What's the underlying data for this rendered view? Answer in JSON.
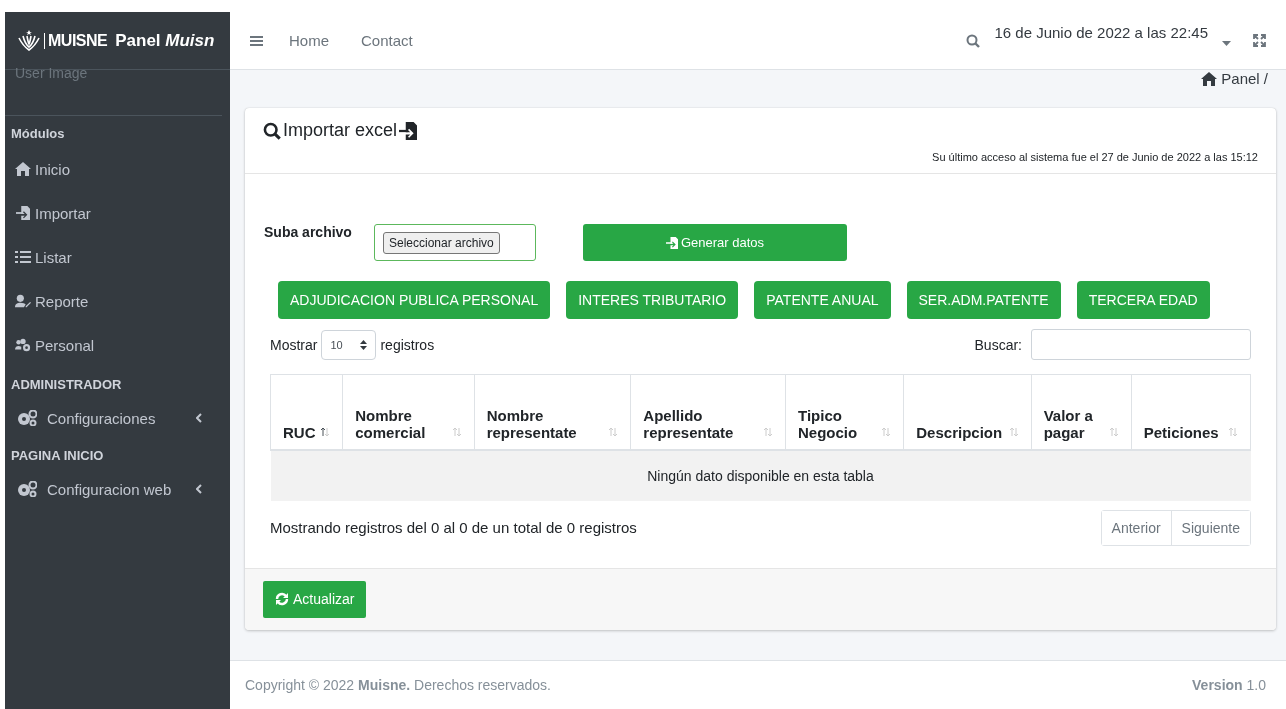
{
  "brand": {
    "logo_text": "MUISNE",
    "title": "Panel ",
    "title_italic": "Muisn"
  },
  "user_image_alt": "User Image",
  "navbar": {
    "links": [
      "Home",
      "Contact"
    ],
    "datetime": "16 de Junio de 2022 a las 22:45"
  },
  "sidebar": {
    "items": [
      {
        "kind": "header",
        "label": "Módulos"
      },
      {
        "kind": "link",
        "label": "Inicio",
        "has_submenu": false
      },
      {
        "kind": "link",
        "label": "Importar",
        "has_submenu": false
      },
      {
        "kind": "link",
        "label": "Listar",
        "has_submenu": false
      },
      {
        "kind": "link",
        "label": "Reporte",
        "has_submenu": false
      },
      {
        "kind": "link",
        "label": "Personal",
        "has_submenu": false
      },
      {
        "kind": "header",
        "label": "ADMINISTRADOR"
      },
      {
        "kind": "link",
        "label": "Configuraciones",
        "has_submenu": true
      },
      {
        "kind": "header",
        "label": "PAGINA INICIO"
      },
      {
        "kind": "link",
        "label": "Configuracion web",
        "has_submenu": true
      }
    ]
  },
  "breadcrumb": "Panel /",
  "card": {
    "title": "Importar excel",
    "last_access": "Su último acceso al sistema fue el 27 de Junio de 2022 a las 15:12",
    "upload_label": "Suba archivo",
    "file_button": "Seleccionar archivo",
    "generate_button": "Generar datos",
    "category_buttons": [
      "ADJUDICACION PUBLICA PERSONAL",
      "INTERES TRIBUTARIO",
      "PATENTE ANUAL",
      "SER.ADM.PATENTE",
      "TERCERA EDAD"
    ],
    "show_prefix": "Mostrar",
    "page_size": "10",
    "show_suffix": "registros",
    "search_label": "Buscar:",
    "table": {
      "columns": [
        {
          "label": "RUC",
          "sorted": true
        },
        {
          "label": "Nombre comercial",
          "sorted": false
        },
        {
          "label": "Nombre representate",
          "sorted": false
        },
        {
          "label": "Apellido representate",
          "sorted": false
        },
        {
          "label": "Tipico Negocio",
          "sorted": false
        },
        {
          "label": "Descripcion",
          "sorted": false
        },
        {
          "label": "Valor a pagar",
          "sorted": false
        },
        {
          "label": "Peticiones",
          "sorted": false
        }
      ],
      "empty_message": "Ningún dato disponible en esta tabla"
    },
    "info": "Mostrando registros del 0 al 0 de un total de 0 registros",
    "pagination": [
      {
        "label": "Anterior",
        "disabled": true
      },
      {
        "label": "Siguiente",
        "disabled": true
      }
    ],
    "refresh_button": "Actualizar"
  },
  "footer": {
    "copyright": "Copyright © 2022 **Muisne.** Derechos reservados.",
    "version_label": "Version",
    "version": "1.0"
  }
}
